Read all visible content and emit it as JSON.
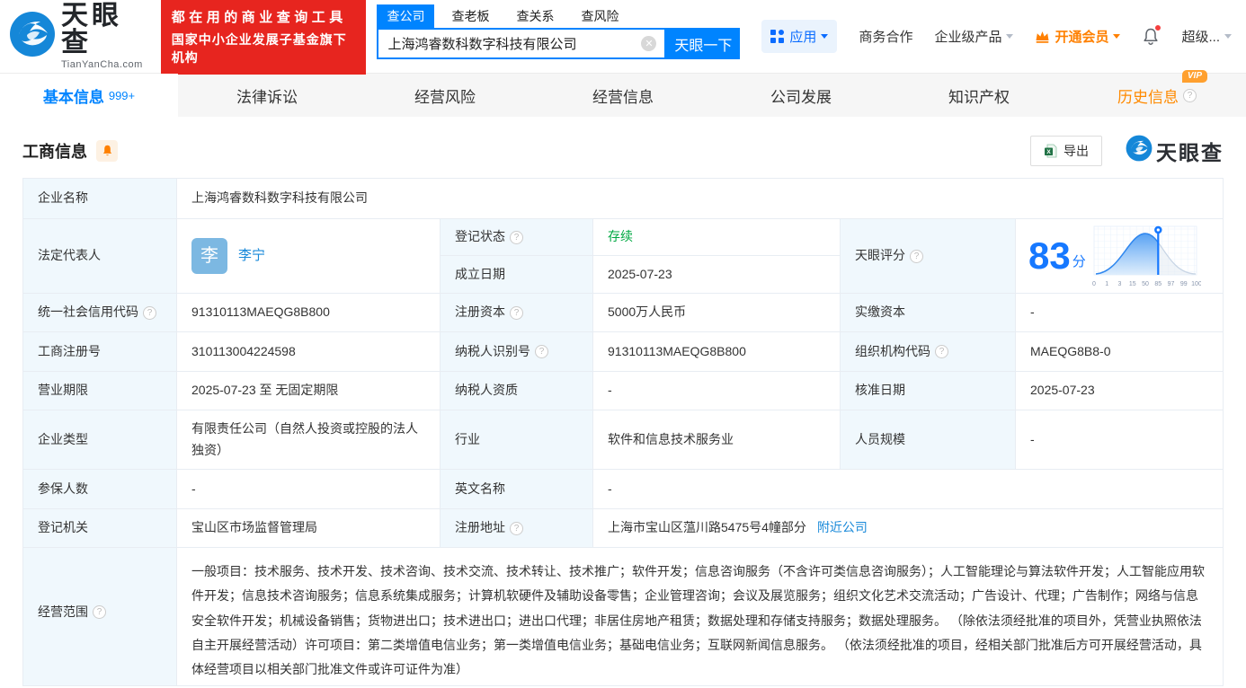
{
  "header": {
    "logo": {
      "title": "天眼查",
      "subtitle": "TianYanCha.com"
    },
    "promo": {
      "line1": "都在用的商业查询工具",
      "line2": "国家中小企业发展子基金旗下机构"
    },
    "search": {
      "tabs": [
        {
          "label": "查公司"
        },
        {
          "label": "查老板"
        },
        {
          "label": "查关系"
        },
        {
          "label": "查风险"
        }
      ],
      "value": "上海鸿睿数科数字科技有限公司",
      "button": "天眼一下"
    },
    "nav": {
      "apps": "应用",
      "cooperation": "商务合作",
      "enterprise": "企业级产品",
      "vip": "开通会员",
      "super": "超级..."
    }
  },
  "tabs": [
    {
      "label": "基本信息",
      "badge": "999+"
    },
    {
      "label": "法律诉讼"
    },
    {
      "label": "经营风险"
    },
    {
      "label": "经营信息"
    },
    {
      "label": "公司发展"
    },
    {
      "label": "知识产权"
    },
    {
      "label": "历史信息",
      "vip": "VIP"
    }
  ],
  "section": {
    "title": "工商信息",
    "export_label": "导出",
    "brand": "天眼查"
  },
  "info": {
    "company_name": {
      "label": "企业名称",
      "value": "上海鸿睿数科数字科技有限公司"
    },
    "legal_rep": {
      "label": "法定代表人",
      "avatar": "李",
      "name": "李宁"
    },
    "reg_status": {
      "label": "登记状态",
      "value": "存续"
    },
    "establish_date": {
      "label": "成立日期",
      "value": "2025-07-23"
    },
    "score": {
      "label": "天眼评分",
      "value": "83",
      "unit": "分"
    },
    "credit_code": {
      "label": "统一社会信用代码",
      "value": "91310113MAEQG8B800"
    },
    "reg_capital": {
      "label": "注册资本",
      "value": "5000万人民币"
    },
    "paid_capital": {
      "label": "实缴资本",
      "value": "-"
    },
    "reg_number": {
      "label": "工商注册号",
      "value": "310113004224598"
    },
    "taxpayer_id": {
      "label": "纳税人识别号",
      "value": "91310113MAEQG8B800"
    },
    "org_code": {
      "label": "组织机构代码",
      "value": "MAEQG8B8-0"
    },
    "business_term": {
      "label": "营业期限",
      "value": "2025-07-23 至 无固定期限"
    },
    "taxpayer_qualification": {
      "label": "纳税人资质",
      "value": "-"
    },
    "approval_date": {
      "label": "核准日期",
      "value": "2025-07-23"
    },
    "company_type": {
      "label": "企业类型",
      "value": "有限责任公司（自然人投资或控股的法人独资）"
    },
    "industry": {
      "label": "行业",
      "value": "软件和信息技术服务业"
    },
    "staff_size": {
      "label": "人员规模",
      "value": "-"
    },
    "insured_count": {
      "label": "参保人数",
      "value": "-"
    },
    "english_name": {
      "label": "英文名称",
      "value": "-"
    },
    "reg_authority": {
      "label": "登记机关",
      "value": "宝山区市场监督管理局"
    },
    "reg_address": {
      "label": "注册地址",
      "value": "上海市宝山区蕰川路5475号4幢部分",
      "link": "附近公司"
    },
    "business_scope": {
      "label": "经营范围",
      "value": "一般项目：技术服务、技术开发、技术咨询、技术交流、技术转让、技术推广；软件开发；信息咨询服务（不含许可类信息咨询服务）；人工智能理论与算法软件开发；人工智能应用软件开发；信息技术咨询服务；信息系统集成服务；计算机软硬件及辅助设备零售；企业管理咨询；会议及展览服务；组织文化艺术交流活动；广告设计、代理；广告制作；网络与信息安全软件开发；机械设备销售；货物进出口；技术进出口；进出口代理；非居住房地产租赁；数据处理和存储支持服务；数据处理服务。 （除依法须经批准的项目外，凭营业执照依法自主开展经营活动）许可项目：第二类增值电信业务；第一类增值电信业务；基础电信业务；互联网新闻信息服务。 （依法须经批准的项目，经相关部门批准后方可开展经营活动，具体经营项目以相关部门批准文件或许可证件为准）"
    }
  },
  "chart_data": {
    "type": "area",
    "title": "天眼评分分布曲线",
    "score": 83,
    "x_labels": [
      "0",
      "1",
      "3",
      "15",
      "50",
      "85",
      "97",
      "99",
      "100"
    ],
    "marker_at_label": "85",
    "curve_peak_label": "50",
    "xlim": [
      0,
      100
    ],
    "grid": true
  },
  "colors": {
    "primary_blue": "#0084ff",
    "link_blue": "#1788d9",
    "score_blue": "#1678ff",
    "orange": "#ff8000",
    "green_status": "#00a842",
    "promo_red": "#e7251f",
    "label_bg": "#f0f8fd",
    "border": "#e8edf3"
  }
}
